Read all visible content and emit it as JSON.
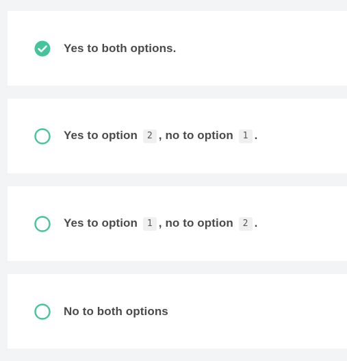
{
  "colors": {
    "accent": "#45c39a",
    "text": "#4a4a4a",
    "card_bg": "#ffffff",
    "page_bg": "#f3f4f6",
    "code_bg": "#f0f0f0"
  },
  "options": [
    {
      "selected": true,
      "icon": "check-circle-icon",
      "label": "Yes to both options."
    },
    {
      "selected": false,
      "icon": "radio-empty-icon",
      "parts": [
        "Yes to option",
        "2",
        ", no to option",
        "1",
        "."
      ]
    },
    {
      "selected": false,
      "icon": "radio-empty-icon",
      "parts": [
        "Yes to option",
        "1",
        ", no to option",
        "2",
        "."
      ]
    },
    {
      "selected": false,
      "icon": "radio-empty-icon",
      "label": "No to both options"
    }
  ]
}
